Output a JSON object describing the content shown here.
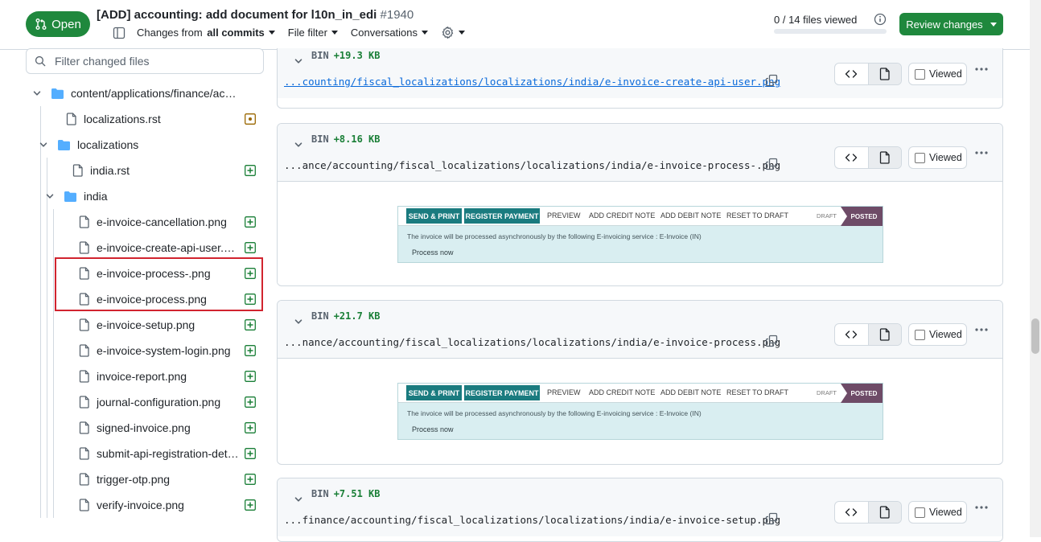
{
  "header": {
    "state_label": "Open",
    "title": "[ADD] accounting: add document for l10n_in_edi",
    "number": "#1940",
    "changes_from_prefix": "Changes from ",
    "changes_from_value": "all commits",
    "file_filter": "File filter",
    "conversations": "Conversations",
    "files_viewed": "0 / 14 files viewed",
    "files_viewed_fraction": 0,
    "review_button": "Review changes"
  },
  "sidebar": {
    "filter_placeholder": "Filter changed files",
    "tree": [
      {
        "label": "content/applications/finance/accou…",
        "kind": "folder",
        "depth": 0
      },
      {
        "label": "localizations.rst",
        "kind": "file",
        "depth": 1,
        "status": "modified"
      },
      {
        "label": "localizations",
        "kind": "folder",
        "depth": 1
      },
      {
        "label": "india.rst",
        "kind": "file",
        "depth": 2,
        "status": "added"
      },
      {
        "label": "india",
        "kind": "folder",
        "depth": 2
      },
      {
        "label": "e-invoice-cancellation.png",
        "kind": "file",
        "depth": 3,
        "status": "added"
      },
      {
        "label": "e-invoice-create-api-user.png",
        "kind": "file",
        "depth": 3,
        "status": "added"
      },
      {
        "label": "e-invoice-process-.png",
        "kind": "file",
        "depth": 3,
        "status": "added"
      },
      {
        "label": "e-invoice-process.png",
        "kind": "file",
        "depth": 3,
        "status": "added"
      },
      {
        "label": "e-invoice-setup.png",
        "kind": "file",
        "depth": 3,
        "status": "added"
      },
      {
        "label": "e-invoice-system-login.png",
        "kind": "file",
        "depth": 3,
        "status": "added"
      },
      {
        "label": "invoice-report.png",
        "kind": "file",
        "depth": 3,
        "status": "added"
      },
      {
        "label": "journal-configuration.png",
        "kind": "file",
        "depth": 3,
        "status": "added"
      },
      {
        "label": "signed-invoice.png",
        "kind": "file",
        "depth": 3,
        "status": "added"
      },
      {
        "label": "submit-api-registration-det…",
        "kind": "file",
        "depth": 3,
        "status": "added"
      },
      {
        "label": "trigger-otp.png",
        "kind": "file",
        "depth": 3,
        "status": "added"
      },
      {
        "label": "verify-invoice.png",
        "kind": "file",
        "depth": 3,
        "status": "added"
      }
    ]
  },
  "diffs": [
    {
      "bin": "BIN",
      "size": "+19.3 KB",
      "path": "...counting/fiscal_localizations/localizations/india/e-invoice-create-api-user.png",
      "viewed_label": "Viewed"
    },
    {
      "bin": "BIN",
      "size": "+8.16 KB",
      "path": "...ance/accounting/fiscal_localizations/localizations/india/e-invoice-process-.png",
      "viewed_label": "Viewed"
    },
    {
      "bin": "BIN",
      "size": "+21.7 KB",
      "path": "...nance/accounting/fiscal_localizations/localizations/india/e-invoice-process.png",
      "viewed_label": "Viewed"
    },
    {
      "bin": "BIN",
      "size": "+7.51 KB",
      "path": "...finance/accounting/fiscal_localizations/localizations/india/e-invoice-setup.png",
      "viewed_label": "Viewed"
    }
  ],
  "preview": {
    "send_print": "SEND & PRINT",
    "register_payment": "REGISTER PAYMENT",
    "preview": "PREVIEW",
    "add_credit_note": "ADD CREDIT NOTE",
    "add_debit_note": "ADD DEBIT NOTE",
    "reset_to_draft": "RESET TO DRAFT",
    "draft": "DRAFT",
    "posted": "POSTED",
    "message": "The invoice will be processed asynchronously by the following E-invoicing service : E-Invoice (IN)",
    "process_now": "Process now"
  },
  "colors": {
    "open_green": "#1f883d",
    "added_green": "#1a7f37",
    "modified_orange": "#9a6700",
    "folder_blue": "#54aeff",
    "highlight_red": "#d1242f"
  }
}
